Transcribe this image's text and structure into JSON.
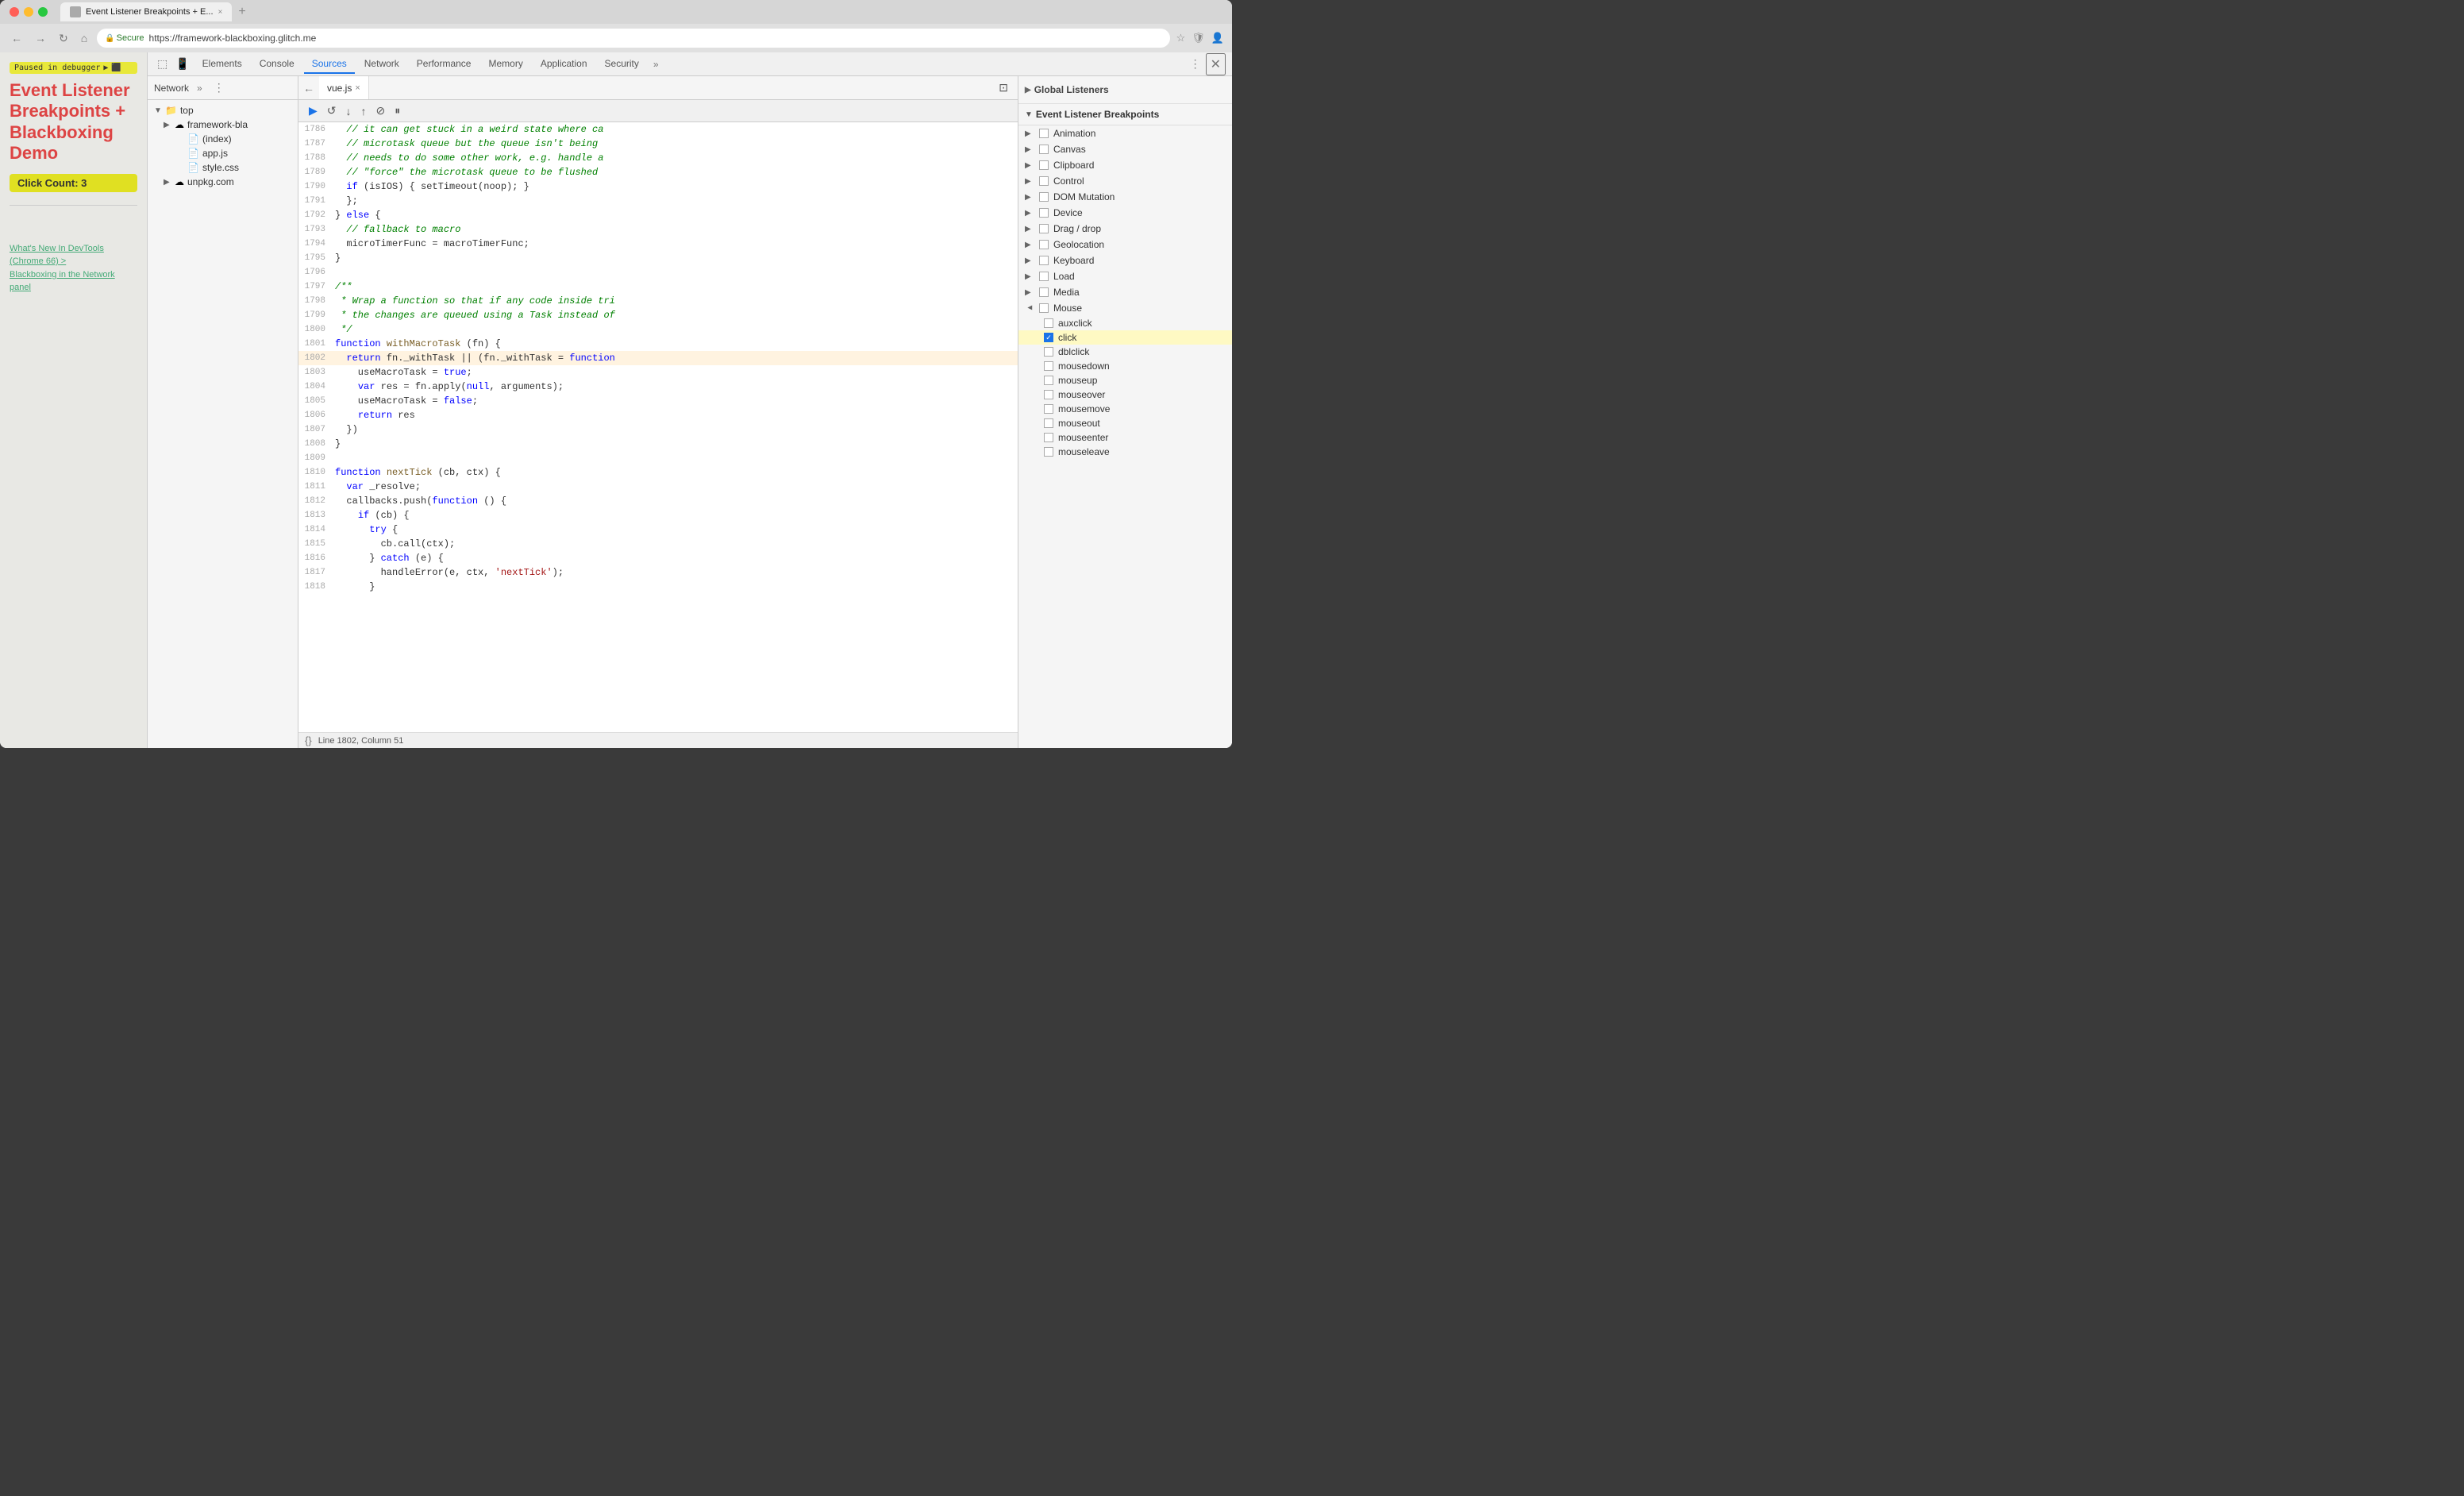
{
  "browser": {
    "tab_title": "Event Listener Breakpoints + E...",
    "tab_close": "×",
    "url_secure": "Secure",
    "url": "https://framework-blackboxing.glitch.me",
    "new_tab_label": "+"
  },
  "devtools_tabs": {
    "tabs": [
      "Elements",
      "Console",
      "Sources",
      "Network",
      "Performance",
      "Memory",
      "Application",
      "Security"
    ],
    "active": "Sources",
    "overflow": "»"
  },
  "debug_toolbar": {
    "resume": "▶",
    "step_over": "↺",
    "step_into": "↓",
    "step_out": "↑",
    "deactivate": "⊘",
    "pause": "⏸"
  },
  "sources_panel": {
    "network_label": "Network",
    "top_label": "top",
    "framework_bla": "framework-bla",
    "index": "(index)",
    "app_js": "app.js",
    "style_css": "style.css",
    "unpkg": "unpkg.com"
  },
  "editor": {
    "tab_filename": "vue.js",
    "tab_close": "×"
  },
  "code_lines": [
    {
      "num": "1786",
      "text": "  // it can get stuck in a weird state where ca",
      "type": "comment"
    },
    {
      "num": "1787",
      "text": "  // microtask queue but the queue isn't being",
      "type": "comment"
    },
    {
      "num": "1788",
      "text": "  // needs to do some other work, e.g. handle a",
      "type": "comment"
    },
    {
      "num": "1789",
      "text": "  // \"force\" the microtask queue to be flushed",
      "type": "comment"
    },
    {
      "num": "1790",
      "text": "  if (isIOS) { setTimeout(noop); }",
      "type": "code"
    },
    {
      "num": "1791",
      "text": "  };",
      "type": "code"
    },
    {
      "num": "1792",
      "text": "} else {",
      "type": "code"
    },
    {
      "num": "1793",
      "text": "  // fallback to macro",
      "type": "comment"
    },
    {
      "num": "1794",
      "text": "  microTimerFunc = macroTimerFunc;",
      "type": "code"
    },
    {
      "num": "1795",
      "text": "}",
      "type": "code"
    },
    {
      "num": "1796",
      "text": "",
      "type": "code"
    },
    {
      "num": "1797",
      "text": "/**",
      "type": "comment"
    },
    {
      "num": "1798",
      "text": " * Wrap a function so that if any code inside tri",
      "type": "comment"
    },
    {
      "num": "1799",
      "text": " * the changes are queued using a Task instead of",
      "type": "comment"
    },
    {
      "num": "1800",
      "text": " */",
      "type": "comment"
    },
    {
      "num": "1801",
      "text": "function withMacroTask (fn) {",
      "type": "code"
    },
    {
      "num": "1802",
      "text": "  return fn._withTask || (fn._withTask = function",
      "type": "active"
    },
    {
      "num": "1803",
      "text": "    useMacroTask = true;",
      "type": "code"
    },
    {
      "num": "1804",
      "text": "    var res = fn.apply(null, arguments);",
      "type": "code"
    },
    {
      "num": "1805",
      "text": "    useMacroTask = false;",
      "type": "code"
    },
    {
      "num": "1806",
      "text": "    return res",
      "type": "code"
    },
    {
      "num": "1807",
      "text": "  })",
      "type": "code"
    },
    {
      "num": "1808",
      "text": "}",
      "type": "code"
    },
    {
      "num": "1809",
      "text": "",
      "type": "code"
    },
    {
      "num": "1810",
      "text": "function nextTick (cb, ctx) {",
      "type": "code"
    },
    {
      "num": "1811",
      "text": "  var _resolve;",
      "type": "code"
    },
    {
      "num": "1812",
      "text": "  callbacks.push(function () {",
      "type": "code"
    },
    {
      "num": "1813",
      "text": "    if (cb) {",
      "type": "code"
    },
    {
      "num": "1814",
      "text": "      try {",
      "type": "code"
    },
    {
      "num": "1815",
      "text": "        cb.call(ctx);",
      "type": "code"
    },
    {
      "num": "1816",
      "text": "      } catch (e) {",
      "type": "code"
    },
    {
      "num": "1817",
      "text": "        handleError(e, ctx, 'nextTick');",
      "type": "code"
    },
    {
      "num": "1818",
      "text": "      }",
      "type": "code"
    }
  ],
  "status_bar": {
    "bracket": "{}",
    "position": "Line 1802, Column 51"
  },
  "page_content": {
    "debugger_badge": "Paused in debugger",
    "title_line1": "Event Listener",
    "title_line2": "Breakpoints +",
    "title_line3": "Blackboxing Demo",
    "click_count": "Click Count: 3",
    "link1": "What's New In DevTools (Chrome 66) >",
    "link2": "Blackboxing in the Network panel"
  },
  "right_panel": {
    "global_listeners_label": "Global Listeners",
    "breakpoints_title": "Event Listener Breakpoints",
    "categories": [
      {
        "label": "Animation",
        "checked": false,
        "expanded": false
      },
      {
        "label": "Canvas",
        "checked": false,
        "expanded": false
      },
      {
        "label": "Clipboard",
        "checked": false,
        "expanded": false
      },
      {
        "label": "Control",
        "checked": false,
        "expanded": false
      },
      {
        "label": "DOM Mutation",
        "checked": false,
        "expanded": false
      },
      {
        "label": "Device",
        "checked": false,
        "expanded": false
      },
      {
        "label": "Drag / drop",
        "checked": false,
        "expanded": false
      },
      {
        "label": "Geolocation",
        "checked": false,
        "expanded": false
      },
      {
        "label": "Keyboard",
        "checked": false,
        "expanded": false
      },
      {
        "label": "Load",
        "checked": false,
        "expanded": false
      },
      {
        "label": "Media",
        "checked": false,
        "expanded": false
      },
      {
        "label": "Mouse",
        "checked": false,
        "expanded": true
      }
    ],
    "mouse_items": [
      {
        "label": "auxclick",
        "checked": false
      },
      {
        "label": "click",
        "checked": true,
        "highlighted": true
      },
      {
        "label": "dblclick",
        "checked": false
      },
      {
        "label": "mousedown",
        "checked": false
      },
      {
        "label": "mouseup",
        "checked": false
      },
      {
        "label": "mouseover",
        "checked": false
      },
      {
        "label": "mousemove",
        "checked": false
      },
      {
        "label": "mouseout",
        "checked": false
      },
      {
        "label": "mouseenter",
        "checked": false
      },
      {
        "label": "mouseleave",
        "checked": false
      }
    ]
  }
}
